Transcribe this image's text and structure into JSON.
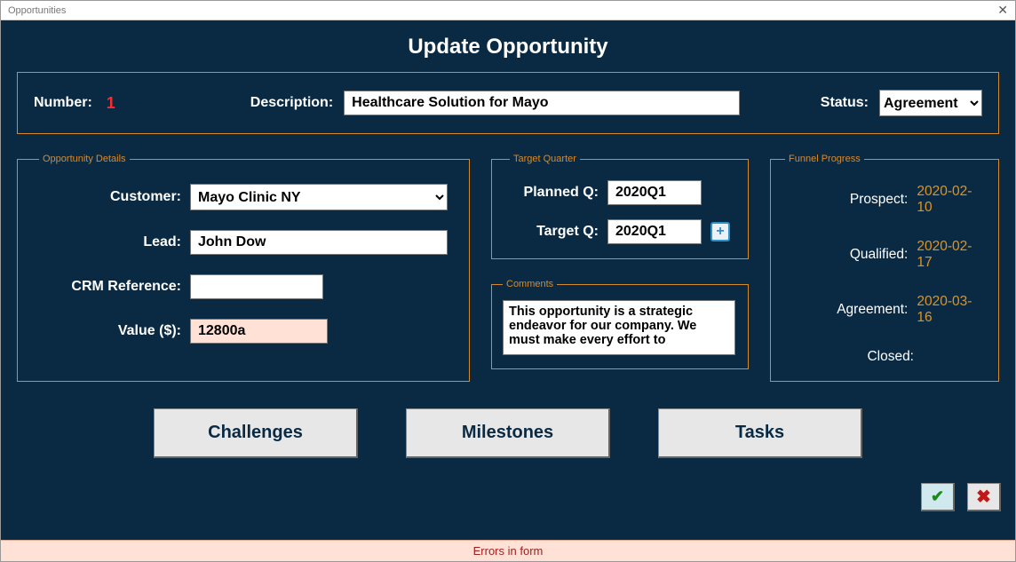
{
  "window": {
    "title": "Opportunities"
  },
  "page": {
    "title": "Update Opportunity"
  },
  "header": {
    "number_label": "Number:",
    "number_value": "1",
    "description_label": "Description:",
    "description_value": "Healthcare Solution for Mayo",
    "status_label": "Status:",
    "status_value": "Agreement"
  },
  "details": {
    "legend": "Opportunity Details",
    "customer_label": "Customer:",
    "customer_value": "Mayo Clinic NY",
    "lead_label": "Lead:",
    "lead_value": "John Dow",
    "crm_label": "CRM Reference:",
    "crm_value": "",
    "value_label": "Value ($):",
    "value_value": "12800a"
  },
  "target": {
    "legend": "Target Quarter",
    "planned_label": "Planned Q:",
    "planned_value": "2020Q1",
    "target_label": "Target Q:",
    "target_value": "2020Q1"
  },
  "comments": {
    "legend": "Comments",
    "text": "This opportunity is a strategic endeavor for our company. We must make every effort to"
  },
  "funnel": {
    "legend": "Funnel Progress",
    "prospect_label": "Prospect:",
    "prospect_value": "2020-02-10",
    "qualified_label": "Qualified:",
    "qualified_value": "2020-02-17",
    "agreement_label": "Agreement:",
    "agreement_value": "2020-03-16",
    "closed_label": "Closed:",
    "closed_value": ""
  },
  "buttons": {
    "challenges": "Challenges",
    "milestones": "Milestones",
    "tasks": "Tasks"
  },
  "footer": {
    "error": "Errors in form"
  }
}
